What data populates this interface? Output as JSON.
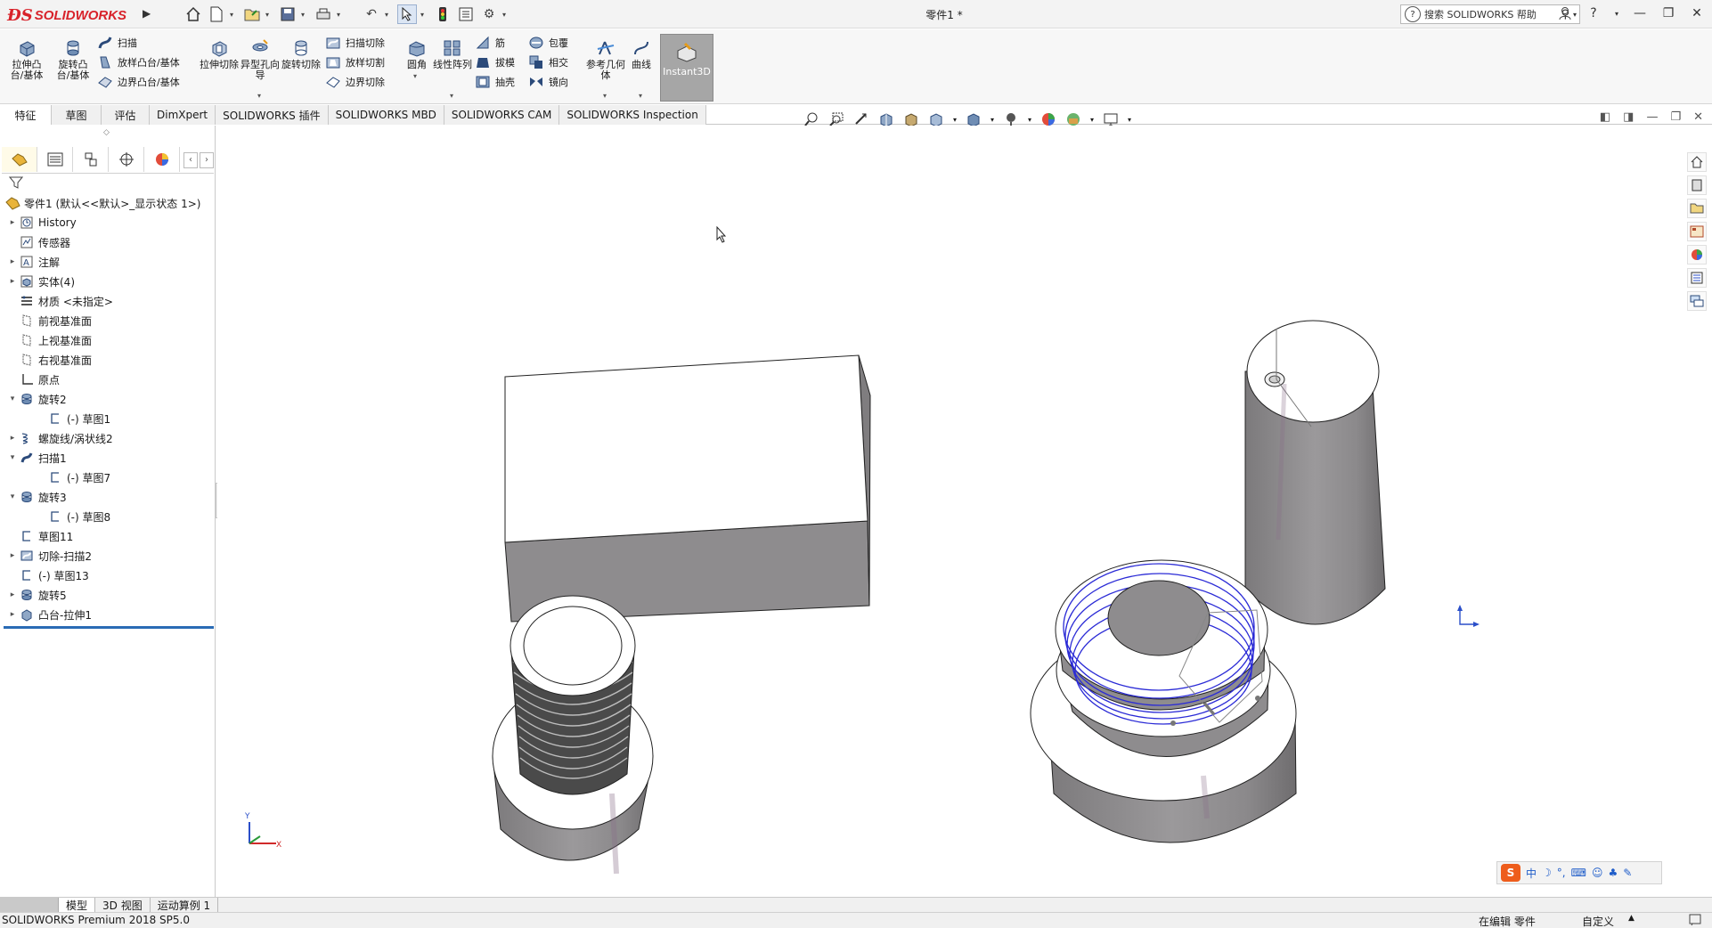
{
  "app": {
    "brand": "SOLIDWORKS",
    "doc_title": "零件1 *",
    "help_search_placeholder": "搜索 SOLIDWORKS 帮助"
  },
  "ribbon": {
    "big": [
      {
        "label": "拉伸凸台/基体",
        "icon": "extrude-boss-icon"
      },
      {
        "label": "旋转凸台/基体",
        "icon": "revolve-boss-icon"
      },
      {
        "label": "拉伸切除",
        "icon": "extrude-cut-icon"
      },
      {
        "label": "异型孔向导",
        "icon": "hole-wizard-icon"
      },
      {
        "label": "旋转切除",
        "icon": "revolve-cut-icon"
      },
      {
        "label": "圆角",
        "icon": "fillet-icon"
      },
      {
        "label": "线性阵列",
        "icon": "linear-pattern-icon"
      },
      {
        "label": "参考几何体",
        "icon": "reference-geometry-icon"
      },
      {
        "label": "曲线",
        "icon": "curves-icon"
      }
    ],
    "small": {
      "sweep": "扫描",
      "loft": "放样凸台/基体",
      "boundary": "边界凸台/基体",
      "sweep_cut": "扫描切除",
      "loft_cut": "放样切割",
      "boundary_cut": "边界切除",
      "rib": "筋",
      "draft": "拔模",
      "shell": "抽壳",
      "wrap": "包覆",
      "intersect": "相交",
      "mirror": "镜向"
    },
    "instant3d": "Instant3D"
  },
  "command_tabs": [
    "特征",
    "草图",
    "评估",
    "DimXpert",
    "SOLIDWORKS 插件",
    "SOLIDWORKS MBD",
    "SOLIDWORKS CAM",
    "SOLIDWORKS Inspection"
  ],
  "tree": {
    "root": "零件1  (默认<<默认>_显示状态 1>)",
    "items": [
      {
        "label": "History",
        "indent": 0,
        "twisty": "▸",
        "icon": "history-icon"
      },
      {
        "label": "传感器",
        "indent": 0,
        "twisty": "",
        "icon": "sensor-icon"
      },
      {
        "label": "注解",
        "indent": 0,
        "twisty": "▸",
        "icon": "annotations-icon"
      },
      {
        "label": "实体(4)",
        "indent": 0,
        "twisty": "▸",
        "icon": "solid-bodies-icon"
      },
      {
        "label": "材质 <未指定>",
        "indent": 0,
        "twisty": "",
        "icon": "material-icon"
      },
      {
        "label": "前视基准面",
        "indent": 0,
        "twisty": "",
        "icon": "plane-icon"
      },
      {
        "label": "上视基准面",
        "indent": 0,
        "twisty": "",
        "icon": "plane-icon"
      },
      {
        "label": "右视基准面",
        "indent": 0,
        "twisty": "",
        "icon": "plane-icon"
      },
      {
        "label": "原点",
        "indent": 0,
        "twisty": "",
        "icon": "origin-icon"
      },
      {
        "label": "旋转2",
        "indent": 0,
        "twisty": "▾",
        "icon": "revolve-feature-icon"
      },
      {
        "label": "(-) 草图1",
        "indent": 1,
        "twisty": "",
        "icon": "sketch-icon"
      },
      {
        "label": "螺旋线/涡状线2",
        "indent": 0,
        "twisty": "▸",
        "icon": "helix-icon"
      },
      {
        "label": "扫描1",
        "indent": 0,
        "twisty": "▾",
        "icon": "sweep-feature-icon"
      },
      {
        "label": "(-) 草图7",
        "indent": 1,
        "twisty": "",
        "icon": "sketch-icon"
      },
      {
        "label": "旋转3",
        "indent": 0,
        "twisty": "▾",
        "icon": "revolve-feature-icon"
      },
      {
        "label": "(-) 草图8",
        "indent": 1,
        "twisty": "",
        "icon": "sketch-icon"
      },
      {
        "label": "草图11",
        "indent": 0,
        "twisty": "",
        "icon": "sketch-icon"
      },
      {
        "label": "切除-扫描2",
        "indent": 0,
        "twisty": "▸",
        "icon": "cut-sweep-icon"
      },
      {
        "label": "(-) 草图13",
        "indent": 0,
        "twisty": "",
        "icon": "sketch-icon"
      },
      {
        "label": "旋转5",
        "indent": 0,
        "twisty": "▸",
        "icon": "revolve-feature-icon"
      },
      {
        "label": "凸台-拉伸1",
        "indent": 0,
        "twisty": "▸",
        "icon": "boss-extrude-icon"
      }
    ]
  },
  "bottom_tabs": [
    "模型",
    "3D 视图",
    "运动算例 1"
  ],
  "status": {
    "left": "SOLIDWORKS Premium 2018 SP5.0",
    "mode": "在编辑 零件",
    "units": "自定义",
    "units_arrow": "▲"
  },
  "ime": {
    "lang": "中"
  },
  "colors": {
    "accent": "#d8222a",
    "selection": "#2a6bb5",
    "body_fill": "#8e8c8e",
    "helix": "#2b2bd6"
  }
}
